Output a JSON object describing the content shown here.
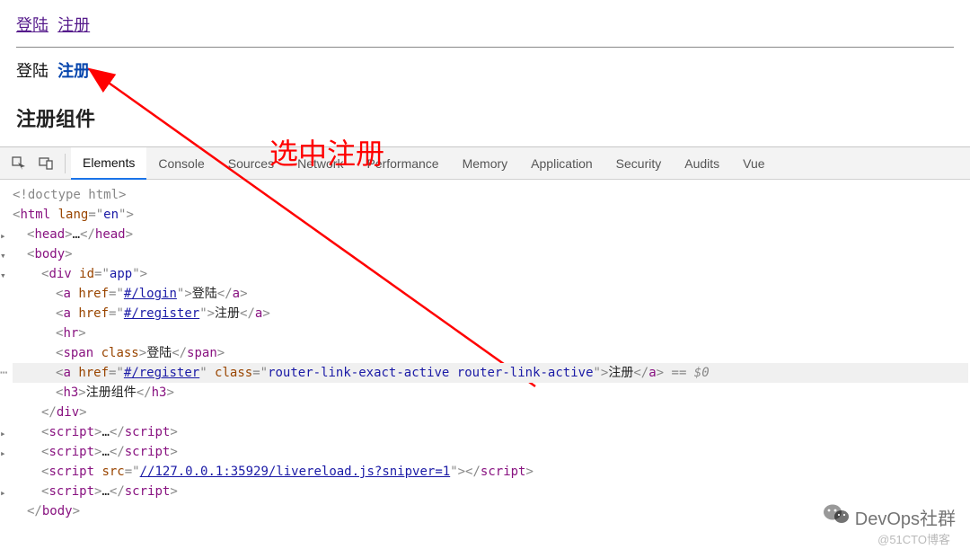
{
  "rendered": {
    "nav_login": "登陆",
    "nav_register": "注册",
    "span_login": "登陆",
    "active_register": "注册",
    "h3_title": "注册组件"
  },
  "annotation": {
    "label": "选中注册"
  },
  "devtools": {
    "tabs": {
      "elements": "Elements",
      "console": "Console",
      "sources": "Sources",
      "network": "Network",
      "performance": "Performance",
      "memory": "Memory",
      "application": "Application",
      "security": "Security",
      "audits": "Audits",
      "vue": "Vue"
    },
    "dom": {
      "doctype_open": "<!doctype html>",
      "html_open_prefix": "<",
      "html_tag": "html",
      "lang_attr": "lang",
      "lang_val": "en",
      "head_tag": "head",
      "ellipsis": "…",
      "body_tag": "body",
      "div_tag": "div",
      "id_attr": "id",
      "id_val": "app",
      "a_tag": "a",
      "href_attr": "href",
      "href_login": "#/login",
      "txt_login": "登陆",
      "href_register": "#/register",
      "txt_register": "注册",
      "hr_tag": "hr",
      "span_tag": "span",
      "class_attr": "class",
      "span_txt": "登陆",
      "active_class": "router-link-exact-active router-link-active",
      "active_txt": "注册",
      "eq_dollar": " == $0",
      "h3_tag": "h3",
      "h3_txt": "注册组件",
      "script_tag": "script",
      "src_attr": "src",
      "src_val": "//127.0.0.1:35929/livereload.js?snipver=1"
    }
  },
  "watermark": {
    "main": "DevOps社群",
    "sub": "@51CTO博客"
  }
}
